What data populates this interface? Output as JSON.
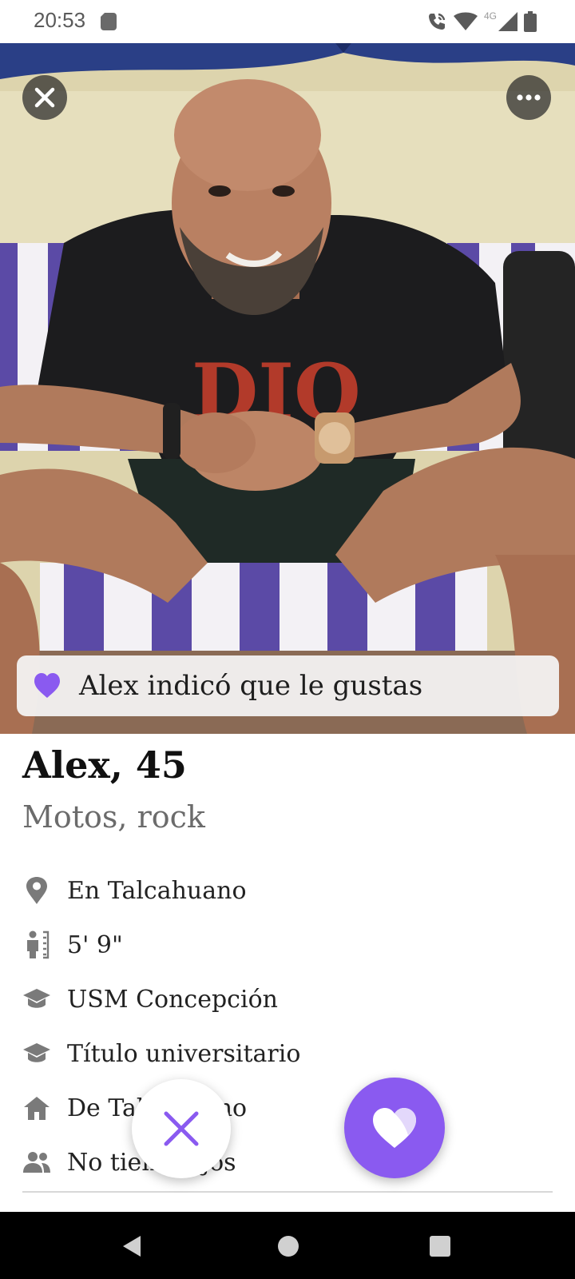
{
  "status_bar": {
    "time": "20:53",
    "network_label": "4G",
    "icons": [
      "sim-card-icon",
      "wifi-call-icon",
      "wifi-icon",
      "signal-icon",
      "battery-icon"
    ]
  },
  "photo": {
    "alt": "Alex profile photo",
    "banner_text": "Alex indicó que le gustas"
  },
  "profile": {
    "name_age": "Alex, 45",
    "tagline": "Motos, rock",
    "details": [
      {
        "icon": "location-pin-icon",
        "text": "En Talcahuano"
      },
      {
        "icon": "height-icon",
        "text": "5' 9\""
      },
      {
        "icon": "graduation-cap-icon",
        "text": "USM Concepción"
      },
      {
        "icon": "graduation-cap-icon",
        "text": "Título universitario"
      },
      {
        "icon": "home-icon",
        "text": "De Talcahuano"
      },
      {
        "icon": "people-icon",
        "text": "No tiene hijos"
      }
    ]
  },
  "colors": {
    "accent": "#8a5af0",
    "text_primary": "#111111",
    "text_secondary": "#6b6b6b",
    "icon_gray": "#7a7a7a"
  },
  "actions": {
    "pass_icon": "close-x-icon",
    "like_icon": "heart-icon"
  }
}
